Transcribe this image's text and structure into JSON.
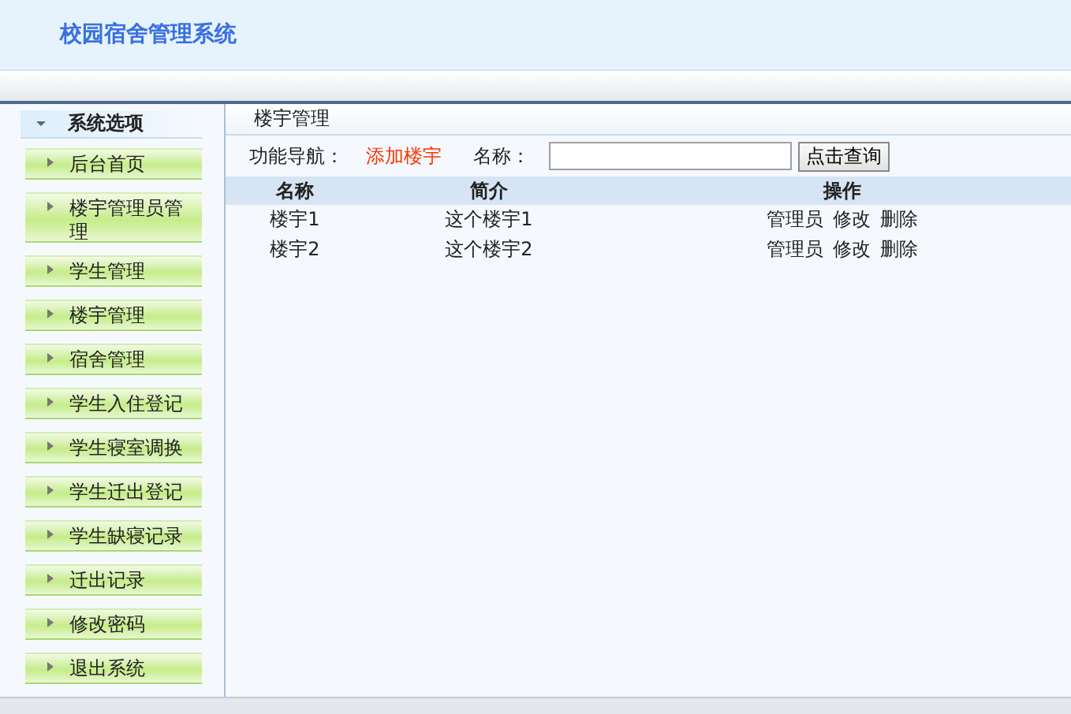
{
  "header": {
    "title": "校园宿舍管理系统"
  },
  "sidebar": {
    "title": "系统选项",
    "expanded": true,
    "items": [
      {
        "label": "后台首页"
      },
      {
        "label": "楼宇管理员管理"
      },
      {
        "label": "学生管理"
      },
      {
        "label": "楼宇管理"
      },
      {
        "label": "宿舍管理"
      },
      {
        "label": "学生入住登记"
      },
      {
        "label": "学生寝室调换"
      },
      {
        "label": "学生迁出登记"
      },
      {
        "label": "学生缺寝记录"
      },
      {
        "label": "迁出记录"
      },
      {
        "label": "修改密码"
      },
      {
        "label": "退出系统"
      }
    ]
  },
  "content": {
    "title": "楼宇管理",
    "nav_label": "功能导航：",
    "nav_link": "添加楼宇",
    "search_label": "名称：",
    "search_button": "点击查询",
    "table": {
      "columns": [
        "名称",
        "简介",
        "操作"
      ],
      "rows": [
        {
          "name": "楼宇1",
          "intro": "这个楼宇1",
          "actions": [
            "管理员",
            "修改",
            "删除"
          ]
        },
        {
          "name": "楼宇2",
          "intro": "这个楼宇2",
          "actions": [
            "管理员",
            "修改",
            "删除"
          ]
        }
      ]
    }
  }
}
